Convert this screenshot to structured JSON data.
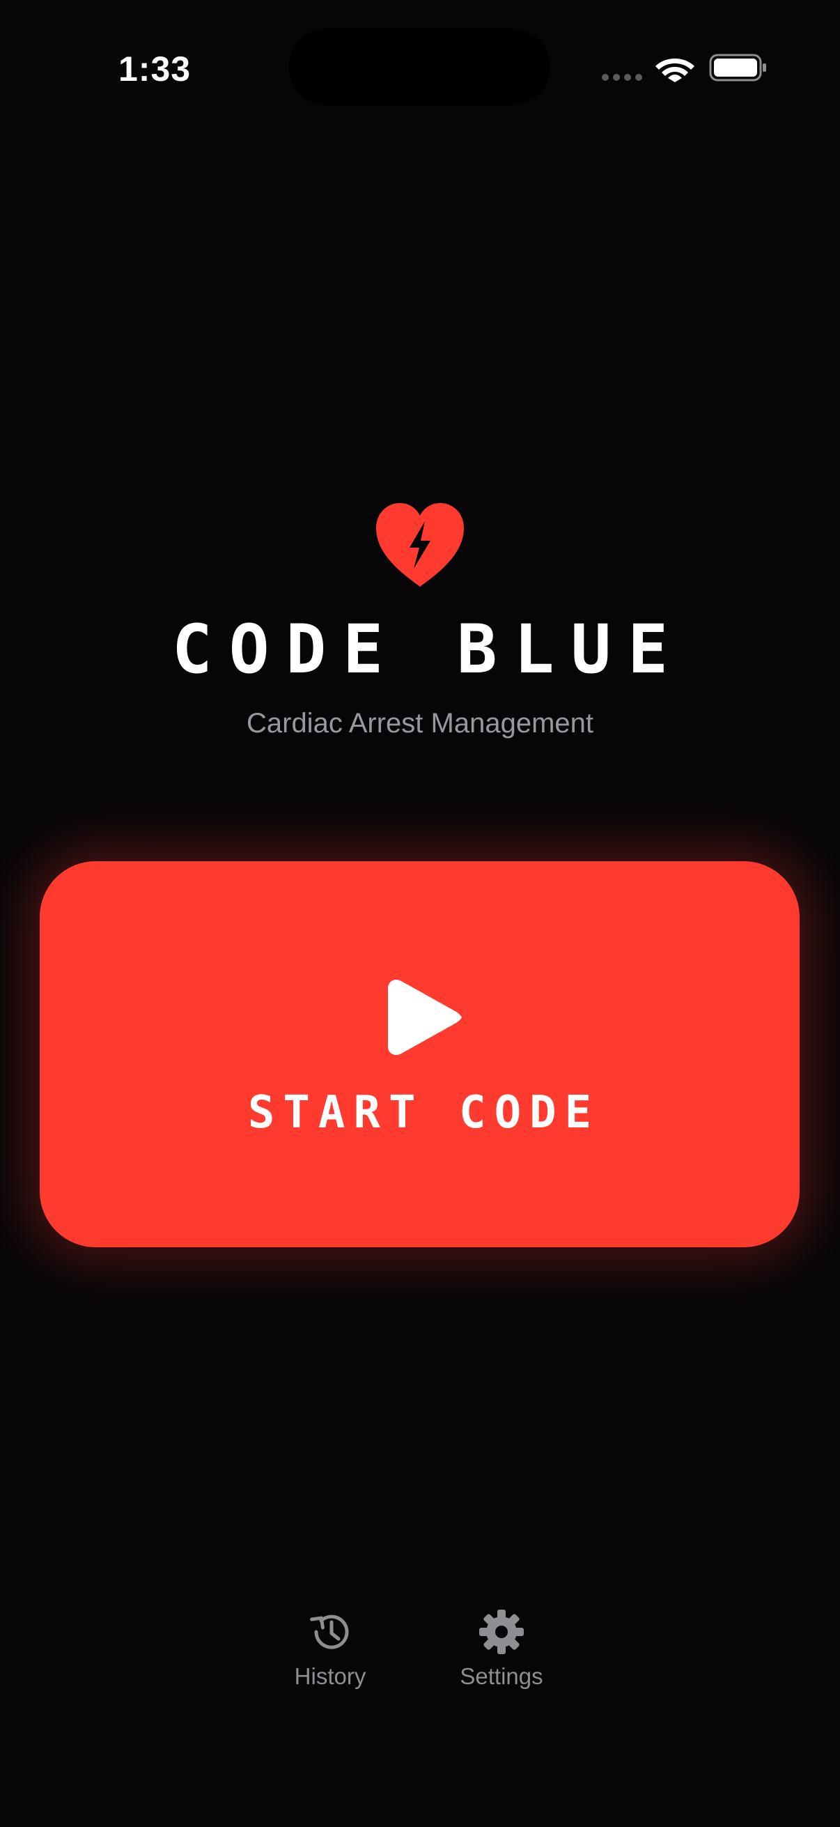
{
  "status_bar": {
    "time": "1:33"
  },
  "header": {
    "title": "CODE BLUE",
    "subtitle": "Cardiac Arrest Management",
    "logo_icon": "heart-bolt-icon"
  },
  "start_button": {
    "label": "START CODE",
    "icon": "play-icon"
  },
  "nav": {
    "items": [
      {
        "label": "History",
        "icon": "history-icon"
      },
      {
        "label": "Settings",
        "icon": "gear-icon"
      }
    ]
  },
  "colors": {
    "background": "#060608",
    "accent": "#ff3b30",
    "subtitle": "#98989f",
    "nav_text": "#8e8e93"
  }
}
